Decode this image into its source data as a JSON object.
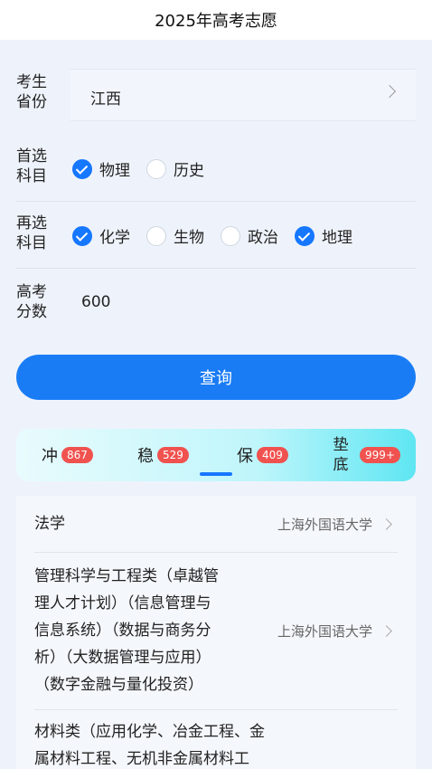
{
  "header": {
    "title": "2025年高考志愿"
  },
  "form": {
    "province": {
      "label": "考生\n省份",
      "label_lines": [
        "考生",
        "省份"
      ],
      "value": "江西"
    },
    "first_subject": {
      "label_lines": [
        "首选",
        "科目"
      ],
      "options": [
        {
          "label": "物理",
          "checked": true
        },
        {
          "label": "历史",
          "checked": false
        }
      ]
    },
    "second_subjects": {
      "label_lines": [
        "再选",
        "科目"
      ],
      "options": [
        {
          "label": "化学",
          "checked": true
        },
        {
          "label": "生物",
          "checked": false
        },
        {
          "label": "政治",
          "checked": false
        },
        {
          "label": "地理",
          "checked": true
        }
      ]
    },
    "score": {
      "label_lines": [
        "高考",
        "分数"
      ],
      "value": "600"
    },
    "query_label": "查询"
  },
  "tabs": [
    {
      "label": "冲",
      "badge": "867",
      "selected": false
    },
    {
      "label": "稳",
      "badge": "529",
      "selected": true
    },
    {
      "label": "保",
      "badge": "409",
      "selected": false
    },
    {
      "label_lines": [
        "垫",
        "底"
      ],
      "badge": "999+",
      "selected": false
    }
  ],
  "results": [
    {
      "major_lines": [
        "法学"
      ],
      "school": "上海外国语大学"
    },
    {
      "major_lines": [
        "管理科学与工程类（卓越管",
        "理人才计划）（信息管理与",
        "信息系统）（数据与商务分",
        "析）（大数据管理与应用）",
        "（数字金融与量化投资）"
      ],
      "school": "上海外国语大学"
    },
    {
      "major_lines": [
        "材料类（应用化学、冶金工程、金",
        "属材料工程、无机非金属材料工"
      ],
      "school": ""
    }
  ],
  "colors": {
    "accent": "#1677ff",
    "badge": "#f0524f",
    "button": "#1a7cf5"
  }
}
